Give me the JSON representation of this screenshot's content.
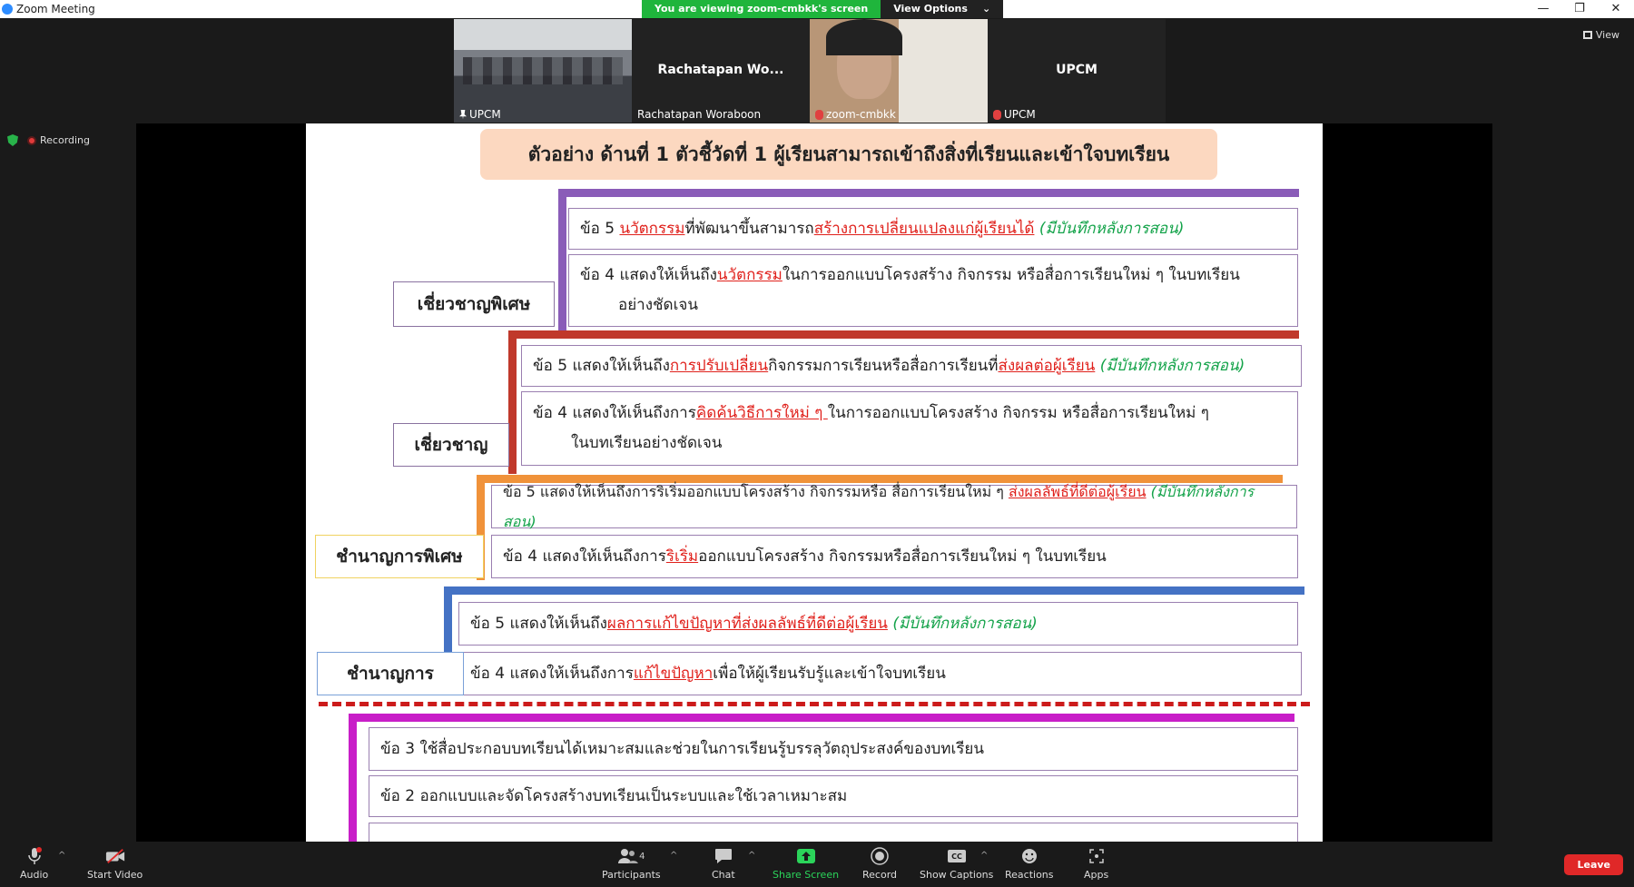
{
  "window": {
    "title": "Zoom Meeting"
  },
  "share_banner": {
    "message": "You are viewing zoom-cmbkk's screen",
    "options_label": "View Options",
    "options_caret": "⌄"
  },
  "window_controls": {
    "minimize": "—",
    "restore": "❐",
    "close": "✕"
  },
  "view_button": {
    "label": "View"
  },
  "participants": [
    {
      "big_name": "",
      "small_name": "UPCM",
      "kind": "room-video"
    },
    {
      "big_name": "Rachatapan  Wo...",
      "small_name": "Rachatapan Woraboon",
      "kind": "name-only"
    },
    {
      "big_name": "",
      "small_name": "zoom-cmbkk",
      "kind": "face-video"
    },
    {
      "big_name": "UPCM",
      "small_name": "UPCM",
      "kind": "name-only"
    }
  ],
  "recording": {
    "label": "Recording"
  },
  "slide": {
    "title": "ตัวอย่าง ด้านที่ 1 ตัวชี้วัดที่ 1 ผู้เรียนสามารถเข้าถึงสิ่งที่เรียนและเข้าใจบทเรียน",
    "levels": {
      "expert_special": "เชี่ยวชาญพิเศษ",
      "expert": "เชี่ยวชาญ",
      "senior_special": "ชำนาญการพิเศษ",
      "senior": "ชำนาญการ"
    },
    "items": {
      "e5_a": "ข้อ 5 ",
      "e5_b": "นวัตกรรม",
      "e5_c": "ที่พัฒนาขึ้นสามารถ",
      "e5_d": "สร้างการเปลี่ยนแปลงแก่ผู้เรียนได้",
      "e5_note": " (มีบันทึกหลังการสอน)",
      "e4_a": "ข้อ 4 แสดงให้เห็นถึง",
      "e4_b": "นวัตกรรม",
      "e4_c": "ในการออกแบบโครงสร้าง กิจกรรม หรือสื่อการเรียนใหม่ ๆ ในบทเรียน",
      "e4_d": "อย่างชัดเจน",
      "x5_a": "ข้อ 5 แสดงให้เห็นถึง",
      "x5_b": "การปรับเปลี่ยน",
      "x5_c": "กิจกรรมการเรียนหรือสื่อการเรียนที่",
      "x5_d": "ส่งผลต่อผู้เรียน",
      "x5_note": " (มีบันทึกหลังการสอน)",
      "x4_a": "ข้อ 4 แสดงให้เห็นถึงการ",
      "x4_b": "คิดค้นวิธีการใหม่ ๆ ",
      "x4_c": "ในการออกแบบโครงสร้าง กิจกรรม หรือสื่อการเรียนใหม่ ๆ",
      "x4_d": "ในบทเรียนอย่างชัดเจน",
      "s5_a": "ข้อ 5 แสดงให้เห็นถึงการริเริ่มออกแบบโครงสร้าง กิจกรรมหรือ สื่อการเรียนใหม่ ๆ ",
      "s5_b": "ส่งผลลัพธ์ที่ดีต่อผู้เรียน",
      "s5_note": " (มีบันทึกหลังการสอน)",
      "s4_a": "ข้อ 4 แสดงให้เห็นถึงการ",
      "s4_b": "ริเริ่ม",
      "s4_c": "ออกแบบโครงสร้าง กิจกรรมหรือสื่อการเรียนใหม่ ๆ ในบทเรียน",
      "n5_a": "ข้อ 5 แสดงให้เห็นถึง",
      "n5_b": "ผลการแก้ไขปัญหาที่ส่งผลลัพธ์ที่ดีต่อผู้เรียน",
      "n5_note": " (มีบันทึกหลังการสอน)",
      "n4_a": "ข้อ 4 แสดงให้เห็นถึงการ",
      "n4_b": "แก้ไขปัญหา",
      "n4_c": "เพื่อให้ผู้เรียนรับรู้และเข้าใจบทเรียน",
      "b3": "ข้อ 3 ใช้สื่อประกอบบทเรียนได้เหมาะสมและช่วยในการเรียนรู้บรรลุวัตถุประสงค์ของบทเรียน",
      "b2": "ข้อ 2 ออกแบบและจัดโครงสร้างบทเรียนเป็นระบบและใช้เวลาเหมาะสม"
    }
  },
  "toolbar": {
    "audio": "Audio",
    "start_video": "Start Video",
    "participants": "Participants",
    "participants_count": "4",
    "chat": "Chat",
    "share_screen": "Share Screen",
    "record": "Record",
    "show_captions": "Show Captions",
    "reactions": "Reactions",
    "apps": "Apps",
    "leave": "Leave",
    "caret": "^"
  },
  "colors": {
    "purple": "#8a5cb8",
    "red": "#c0392b",
    "orange": "#f0923a",
    "blue": "#4472c4",
    "magenta": "#c81ec8",
    "green_share": "#1fb53c",
    "leave": "#e02828"
  }
}
